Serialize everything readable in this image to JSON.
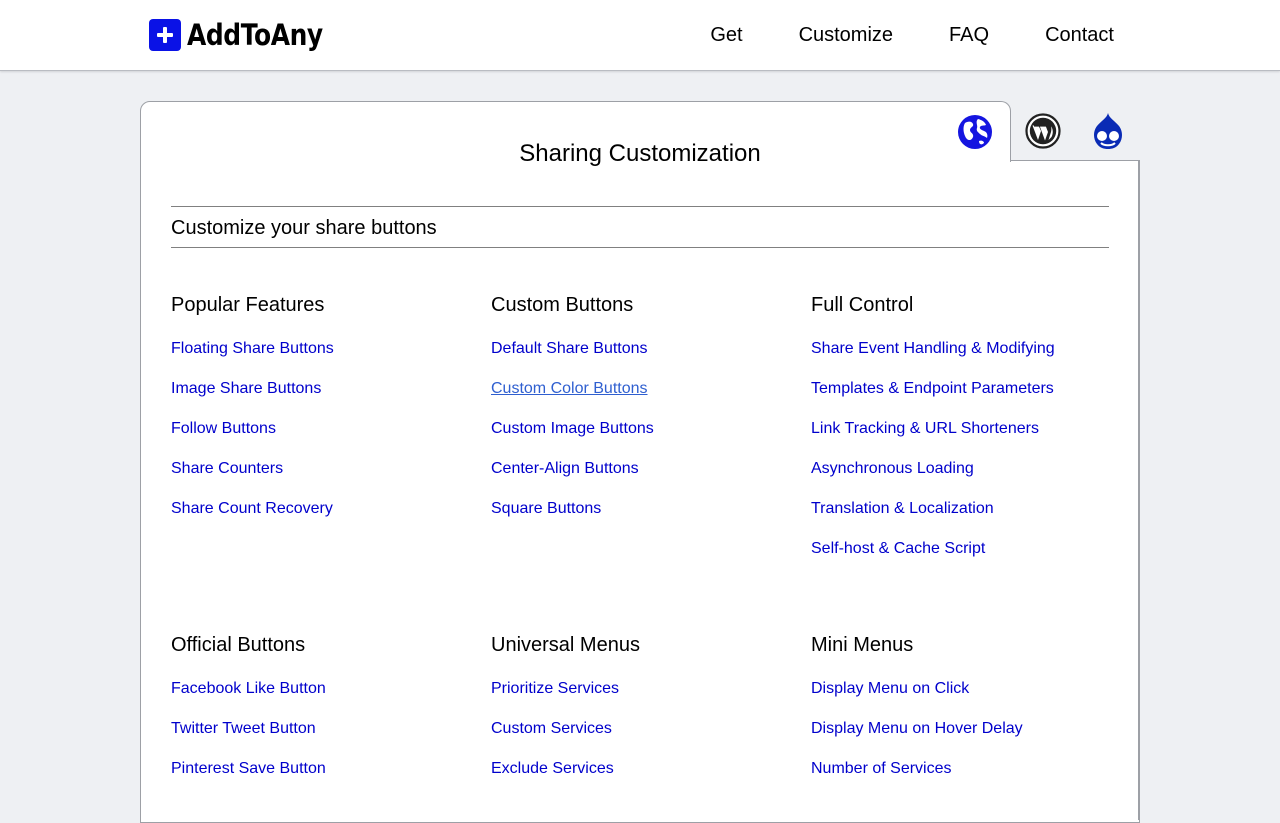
{
  "header": {
    "logo_text": "AddToAny",
    "nav": [
      "Get",
      "Customize",
      "FAQ",
      "Contact"
    ]
  },
  "tabs": [
    {
      "icon": "globe-icon",
      "active": true
    },
    {
      "icon": "wordpress-icon",
      "active": false
    },
    {
      "icon": "drupal-icon",
      "active": false
    }
  ],
  "main": {
    "title": "Sharing Customization",
    "subheader": "Customize your share buttons",
    "sections": [
      {
        "heading": "Popular Features",
        "links": [
          "Floating Share Buttons",
          "Image Share Buttons",
          "Follow Buttons",
          "Share Counters",
          "Share Count Recovery"
        ]
      },
      {
        "heading": "Custom Buttons",
        "links": [
          "Default Share Buttons",
          "Custom Color Buttons",
          "Custom Image Buttons",
          "Center-Align Buttons",
          "Square Buttons"
        ]
      },
      {
        "heading": "Full Control",
        "links": [
          "Share Event Handling & Modifying",
          "Templates & Endpoint Parameters",
          "Link Tracking & URL Shorteners",
          "Asynchronous Loading",
          "Translation & Localization",
          "Self-host & Cache Script"
        ]
      },
      {
        "heading": "Official Buttons",
        "links": [
          "Facebook Like Button",
          "Twitter Tweet Button",
          "Pinterest Save Button"
        ]
      },
      {
        "heading": "Universal Menus",
        "links": [
          "Prioritize Services",
          "Custom Services",
          "Exclude Services"
        ]
      },
      {
        "heading": "Mini Menus",
        "links": [
          "Display Menu on Click",
          "Display Menu on Hover Delay",
          "Number of Services"
        ]
      }
    ],
    "hovered_link": "Custom Color Buttons"
  },
  "colors": {
    "link": "#0000cc",
    "brand": "#0a12e6",
    "background": "#eef0f3"
  }
}
